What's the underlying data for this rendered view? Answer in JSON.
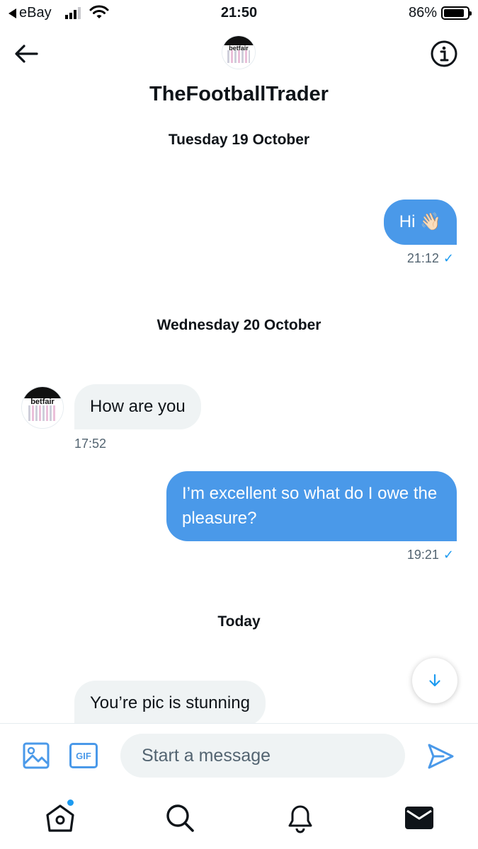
{
  "status_bar": {
    "back_app": "eBay",
    "time": "21:50",
    "battery": "86%"
  },
  "header": {
    "name": "TheFootballTrader",
    "avatar_logo": "betfair"
  },
  "conversation": {
    "separators": [
      "Tuesday 19 October",
      "Wednesday 20 October",
      "Today"
    ],
    "messages": [
      {
        "direction": "out",
        "text": "Hi 👋🏻",
        "time": "21:12",
        "read": "✓"
      },
      {
        "direction": "in",
        "text": "How are you",
        "time": "17:52"
      },
      {
        "direction": "out",
        "text": "I’m excellent so what do I owe the pleasure?",
        "time": "19:21",
        "read": "✓"
      },
      {
        "direction": "in",
        "text": "You’re pic is stunning"
      }
    ]
  },
  "composer": {
    "placeholder": "Start a message",
    "gif_label": "GIF"
  },
  "icons": {
    "back": "arrow-left-icon",
    "info": "info-icon",
    "media": "image-icon",
    "send": "send-icon",
    "scroll": "arrow-down-icon",
    "tabs": [
      "home-icon",
      "search-icon",
      "bell-icon",
      "mail-icon"
    ]
  },
  "colors": {
    "accent": "#1d9bf0",
    "bubble_out": "#4a99e9",
    "bubble_in": "#eff3f4"
  }
}
